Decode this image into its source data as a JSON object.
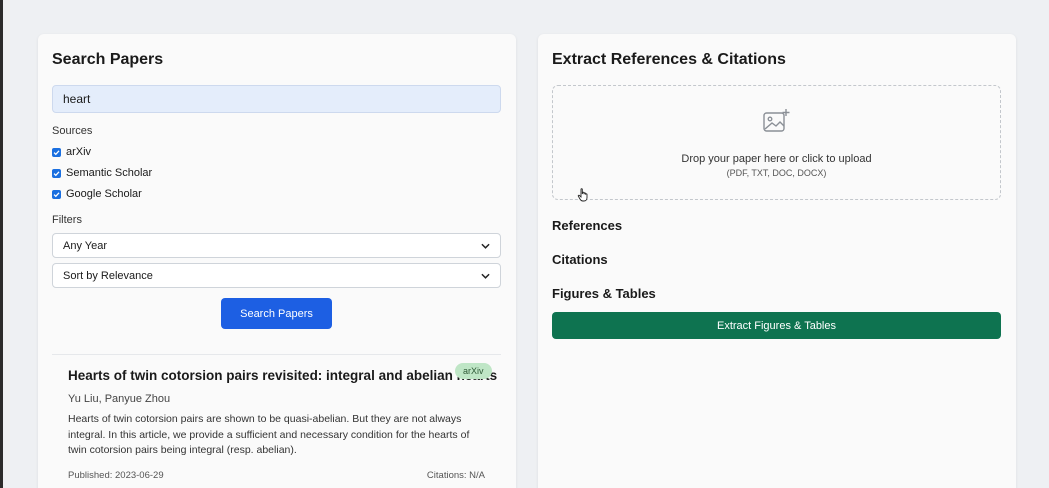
{
  "search_panel": {
    "title": "Search Papers",
    "query": "heart",
    "sources_label": "Sources",
    "sources": [
      {
        "label": "arXiv",
        "checked": true
      },
      {
        "label": "Semantic Scholar",
        "checked": true
      },
      {
        "label": "Google Scholar",
        "checked": true
      }
    ],
    "filters_label": "Filters",
    "year_select": "Any Year",
    "sort_select": "Sort by Relevance",
    "search_button": "Search Papers"
  },
  "results": [
    {
      "title": "Hearts of twin cotorsion pairs revisited: integral and abelian hearts",
      "source_badge": "arXiv",
      "authors": "Yu Liu, Panyue Zhou",
      "abstract": "Hearts of twin cotorsion pairs are shown to be quasi-abelian. But they are not always integral. In this article, we provide a sufficient and necessary condition for the hearts of twin cotorsion pairs being integral (resp. abelian).",
      "published": "Published: 2023-06-29",
      "citations": "Citations: N/A"
    }
  ],
  "extract_panel": {
    "title": "Extract References & Citations",
    "drop_text": "Drop your paper here or click to upload",
    "drop_formats": "(PDF, TXT, DOC, DOCX)",
    "references_heading": "References",
    "citations_heading": "Citations",
    "figures_heading": "Figures & Tables",
    "extract_button": "Extract Figures & Tables"
  },
  "colors": {
    "primary_blue": "#1d5fe3",
    "extract_green": "#0e7350",
    "badge_green": "#bfe6c6"
  },
  "icons": {
    "upload": "image-add-icon",
    "checkbox": "check-icon",
    "select_arrow": "chevron-down-icon",
    "pointer": "hand-cursor-icon"
  }
}
